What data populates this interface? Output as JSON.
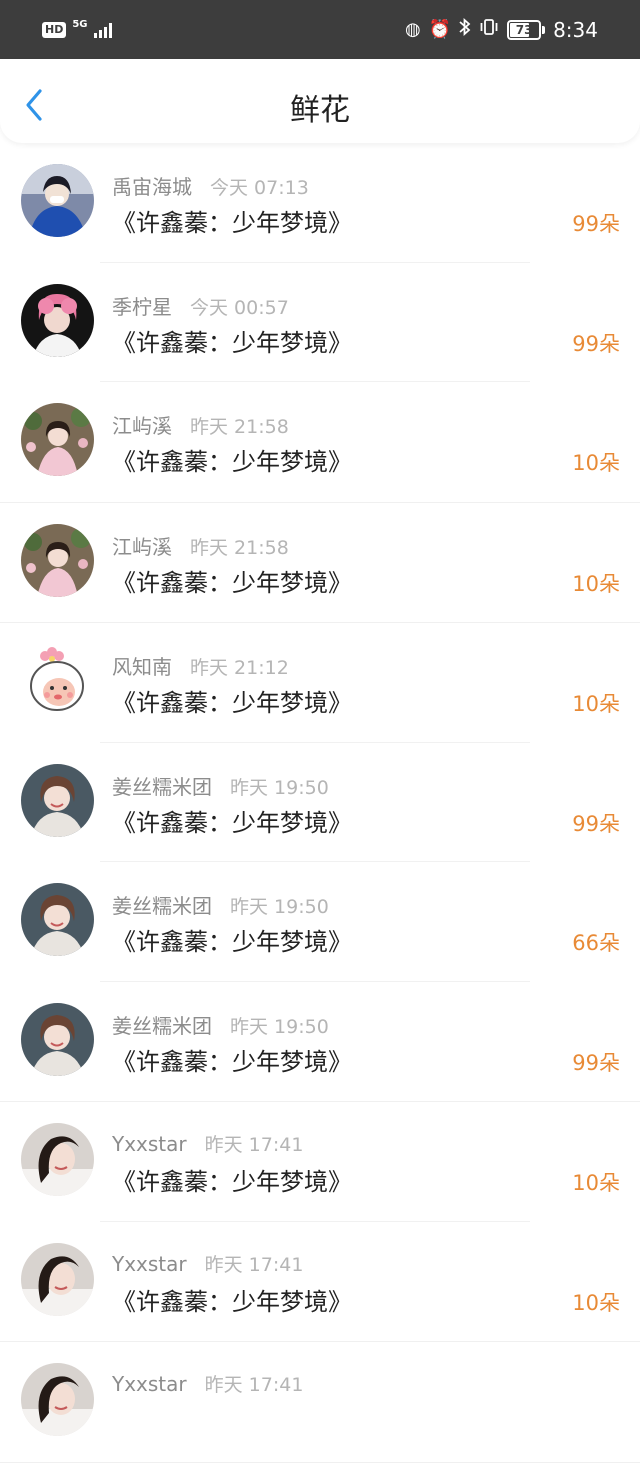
{
  "status_bar": {
    "hd": "HD",
    "network": "5G",
    "battery": "73",
    "battery_level": 0.73,
    "time": "8:34"
  },
  "header": {
    "title": "鲜花",
    "back_icon": "chevron-left-icon"
  },
  "records": [
    {
      "name": "禹宙海城",
      "time": "今天 07:13",
      "book": "《许鑫蓁：少年梦境》",
      "amount": "99朵",
      "avatar": "avatar-blue-hoodie"
    },
    {
      "name": "季柠星",
      "time": "今天 00:57",
      "book": "《许鑫蓁：少年梦境》",
      "amount": "99朵",
      "avatar": "avatar-pink-hair"
    },
    {
      "name": "江屿溪",
      "time": "昨天 21:58",
      "book": "《许鑫蓁：少年梦境》",
      "amount": "10朵",
      "avatar": "avatar-floral-dress"
    },
    {
      "name": "江屿溪",
      "time": "昨天 21:58",
      "book": "《许鑫蓁：少年梦境》",
      "amount": "10朵",
      "avatar": "avatar-floral-dress"
    },
    {
      "name": "风知南",
      "time": "昨天 21:12",
      "book": "《许鑫蓁：少年梦境》",
      "amount": "10朵",
      "avatar": "avatar-cartoon-sheep"
    },
    {
      "name": "姜丝糯米团",
      "time": "昨天 19:50",
      "book": "《许鑫蓁：少年梦境》",
      "amount": "99朵",
      "avatar": "avatar-smiling-girl"
    },
    {
      "name": "姜丝糯米团",
      "time": "昨天 19:50",
      "book": "《许鑫蓁：少年梦境》",
      "amount": "66朵",
      "avatar": "avatar-smiling-girl"
    },
    {
      "name": "姜丝糯米团",
      "time": "昨天 19:50",
      "book": "《许鑫蓁：少年梦境》",
      "amount": "99朵",
      "avatar": "avatar-smiling-girl"
    },
    {
      "name": "Yxxstar",
      "time": "昨天 17:41",
      "book": "《许鑫蓁：少年梦境》",
      "amount": "10朵",
      "avatar": "avatar-lying-girl"
    },
    {
      "name": "Yxxstar",
      "time": "昨天 17:41",
      "book": "《许鑫蓁：少年梦境》",
      "amount": "10朵",
      "avatar": "avatar-lying-girl"
    },
    {
      "name": "Yxxstar",
      "time": "昨天 17:41",
      "book": "",
      "amount": "",
      "avatar": "avatar-lying-girl"
    }
  ],
  "colors": {
    "status_bar": "#3d3d3d",
    "accent": "#e88a36",
    "back_icon": "#2f93e8",
    "name_text": "#8c8c8c",
    "time_text": "#b5b5b5"
  }
}
